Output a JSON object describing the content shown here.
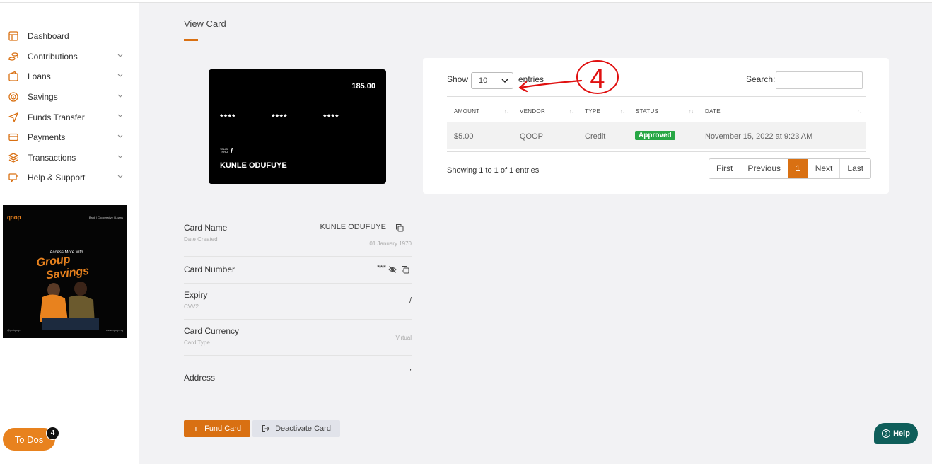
{
  "sidebar": {
    "items": [
      {
        "label": "Dashboard",
        "icon": "dashboard-icon",
        "has_chevron": false
      },
      {
        "label": "Contributions",
        "icon": "coins-icon",
        "has_chevron": true
      },
      {
        "label": "Loans",
        "icon": "wallet-icon",
        "has_chevron": true
      },
      {
        "label": "Savings",
        "icon": "target-icon",
        "has_chevron": true
      },
      {
        "label": "Funds Transfer",
        "icon": "send-icon",
        "has_chevron": true
      },
      {
        "label": "Payments",
        "icon": "credit-card-icon",
        "has_chevron": true
      },
      {
        "label": "Transactions",
        "icon": "layers-icon",
        "has_chevron": true
      },
      {
        "label": "Help & Support",
        "icon": "support-icon",
        "has_chevron": true
      }
    ],
    "promo": {
      "brand": "qoop",
      "tagline": "Bank | Cooperative | Loans",
      "headline_small": "Access More with",
      "headline_1": "Group",
      "headline_2": "Savings",
      "handle": "@getqoop",
      "website": "www.qoop.ng"
    }
  },
  "page": {
    "title": "View Card"
  },
  "card": {
    "balance": "185.00",
    "mask_groups": [
      "****",
      "****",
      "****"
    ],
    "valid_thru_label": "VALID THRU",
    "expiry": "/",
    "holder": "KUNLE ODUFUYE"
  },
  "annotation": {
    "text": "4"
  },
  "table": {
    "show_label": "Show",
    "page_size": "10",
    "entries_label": "entries",
    "search_label": "Search:",
    "search_value": "",
    "columns": [
      "AMOUNT",
      "VENDOR",
      "TYPE",
      "STATUS",
      "DATE"
    ],
    "rows": [
      {
        "amount": "$5.00",
        "vendor": "QOOP",
        "type": "Credit",
        "status": "Approved",
        "date": "November 15, 2022 at 9:23 AM"
      }
    ],
    "info": "Showing 1 to 1 of 1 entries",
    "pagination": {
      "first": "First",
      "previous": "Previous",
      "current": "1",
      "next": "Next",
      "last": "Last"
    }
  },
  "details": {
    "card_name_label": "Card Name",
    "card_name_value": "KUNLE ODUFUYE",
    "date_created_label": "Date Created",
    "date_created_value": "01 January 1970",
    "card_number_label": "Card Number",
    "card_number_value": "***",
    "expiry_label": "Expiry",
    "cvv_label": "CVV2",
    "expiry_value": "/",
    "currency_label": "Card Currency",
    "card_type_label": "Card Type",
    "card_type_value": "Virtual",
    "address_label": "Address",
    "address_value": ","
  },
  "actions": {
    "fund_label": "Fund Card",
    "deactivate_label": "Deactivate Card"
  },
  "widgets": {
    "todos_label": "To Dos",
    "todos_count": "4",
    "help_label": "Help"
  },
  "colors": {
    "accent": "#d97012",
    "approved": "#28a745",
    "help_bg": "#0f5e5a"
  }
}
